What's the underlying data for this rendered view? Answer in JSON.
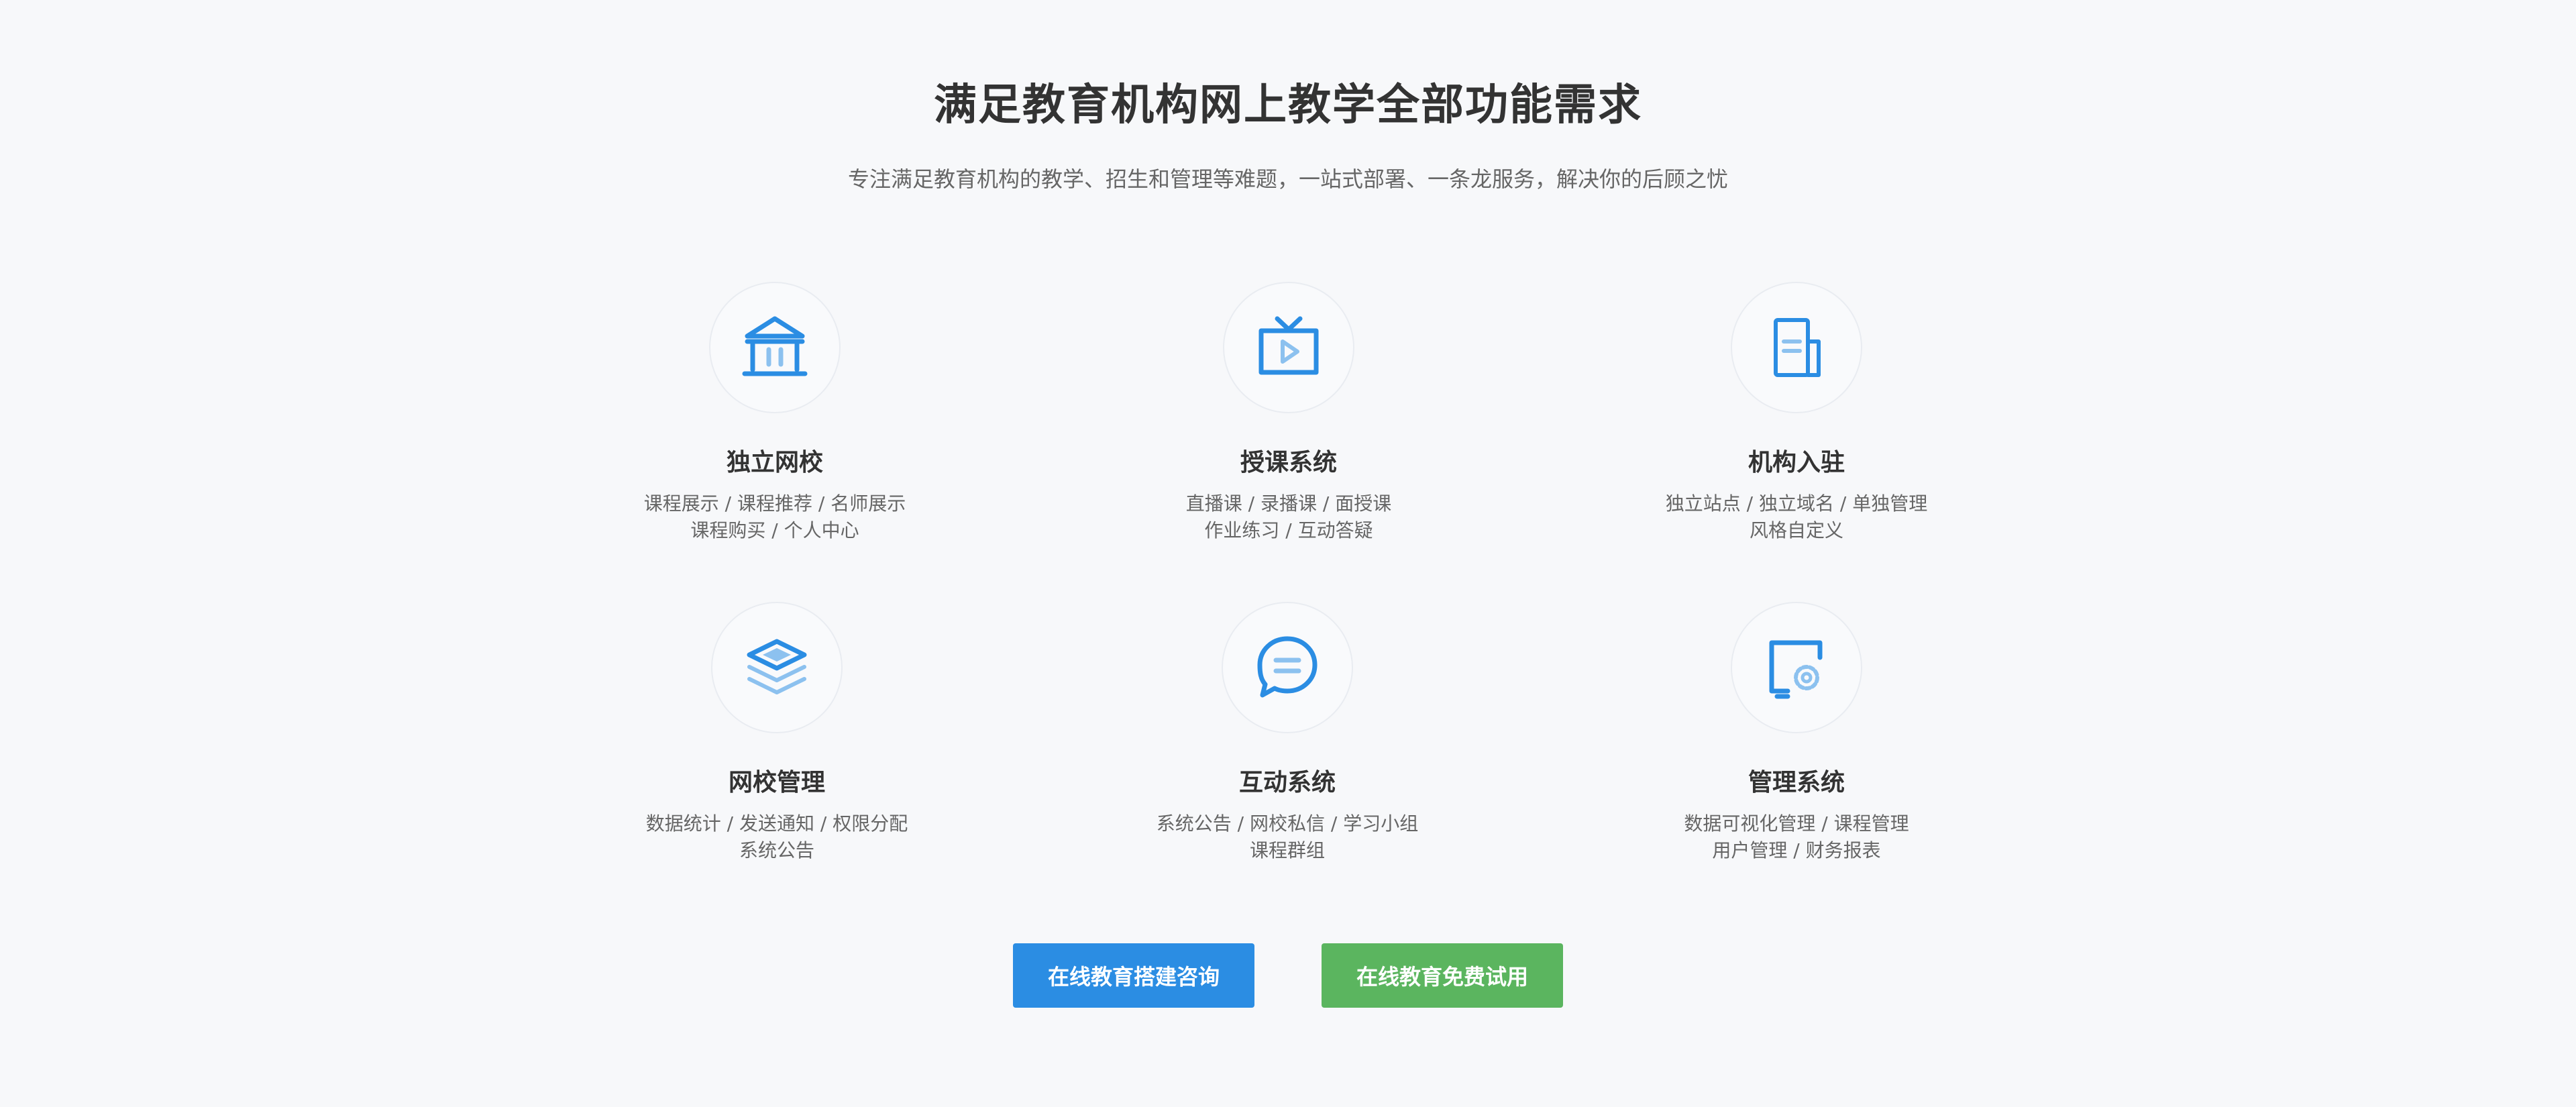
{
  "header": {
    "title": "满足教育机构网上教学全部功能需求",
    "subtitle": "专注满足教育机构的教学、招生和管理等难题，一站式部署、一条龙服务，解决你的后顾之忧"
  },
  "colors": {
    "accent_blue": "#2b8de3",
    "accent_green": "#5bb55f",
    "icon_light_blue": "#8cc1ef"
  },
  "features": [
    {
      "icon": "school-building-icon",
      "title": "独立网校",
      "lines": [
        "课程展示 / 课程推荐 / 名师展示",
        "课程购买 / 个人中心"
      ]
    },
    {
      "icon": "tv-play-icon",
      "title": "授课系统",
      "lines": [
        "直播课 / 录播课 / 面授课",
        "作业练习 /  互动答疑"
      ]
    },
    {
      "icon": "document-icon",
      "title": "机构入驻",
      "lines": [
        "独立站点 / 独立域名 / 单独管理",
        "风格自定义"
      ]
    },
    {
      "icon": "layers-icon",
      "title": "网校管理",
      "lines": [
        "数据统计 /  发送通知  / 权限分配",
        "系统公告"
      ]
    },
    {
      "icon": "chat-bubble-icon",
      "title": "互动系统",
      "lines": [
        "系统公告 / 网校私信 / 学习小组",
        "课程群组"
      ]
    },
    {
      "icon": "settings-gear-icon",
      "title": "管理系统",
      "lines": [
        "数据可视化管理 / 课程管理",
        "用户管理 / 财务报表"
      ]
    }
  ],
  "buttons": {
    "consult_label": "在线教育搭建咨询",
    "trial_label": "在线教育免费试用"
  }
}
